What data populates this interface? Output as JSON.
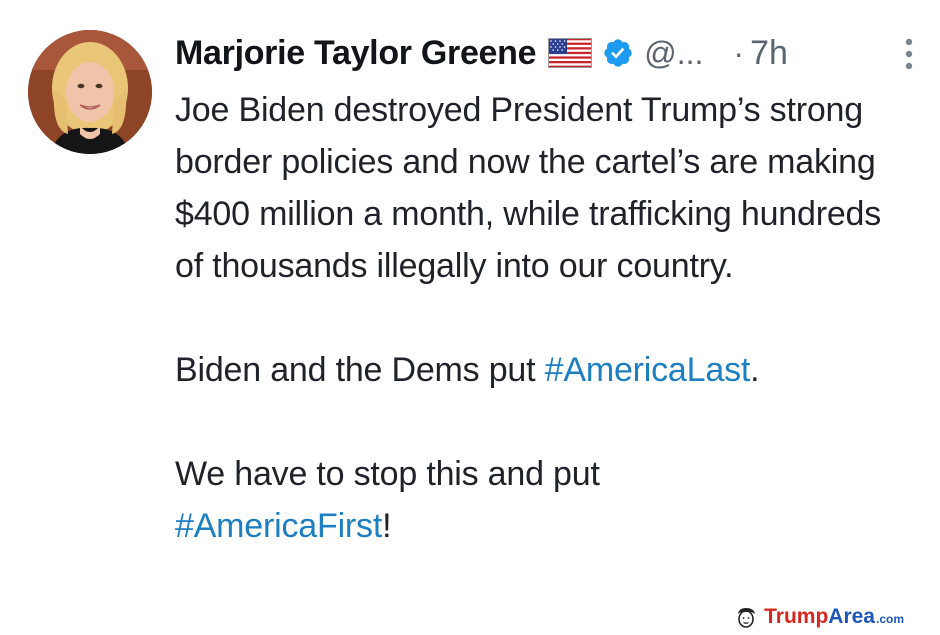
{
  "author": {
    "name": "Marjorie Taylor Greene",
    "handle": "@...",
    "separator": "·",
    "time": "7h"
  },
  "tweet": {
    "paragraph1": "Joe Biden destroyed President Trump’s strong border policies and now the cartel’s are making $400 million a month, while trafficking hundreds of thousands illegally into our country.",
    "p2_text": "Biden and the Dems put ",
    "p2_hashtag": "#AmericaLast",
    "p2_end": ".",
    "p3_text": "We have to stop this and put ",
    "p3_hashtag": "#AmericaFirst",
    "p3_end": "!"
  },
  "watermark": {
    "trump": "Trump",
    "area": "Area",
    "com": ".com"
  },
  "icons": {
    "flag": "us-flag-icon",
    "verified": "verified-badge-icon",
    "more": "more-vertical-icon",
    "watermark": "trump-face-icon"
  },
  "colors": {
    "hashtag": "#1d7ec2",
    "verified": "#1d9bf0",
    "watermark_red": "#d6281f",
    "watermark_blue": "#1d57b8"
  }
}
